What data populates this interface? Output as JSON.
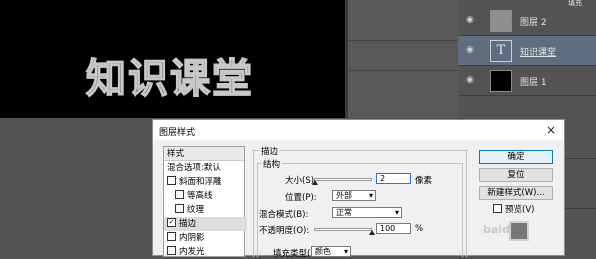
{
  "canvas": {
    "text": "知识课堂"
  },
  "layers": [
    {
      "name": "图层 2",
      "thumb": "gray",
      "selected": false
    },
    {
      "name": "知识课堂",
      "thumb": "text",
      "thumb_glyph": "T",
      "selected": true
    },
    {
      "name": "图层 1",
      "thumb": "black",
      "selected": false
    }
  ],
  "layers_panel": {
    "corner_label": "填充"
  },
  "dialog": {
    "title": "图层样式",
    "close_glyph": "×",
    "style_list": {
      "header": "样式",
      "items": [
        {
          "label": "混合选项:默认",
          "checkbox": false,
          "checked": false,
          "indent": 0
        },
        {
          "label": "斜面和浮雕",
          "checkbox": true,
          "checked": false,
          "indent": 0
        },
        {
          "label": "等高线",
          "checkbox": true,
          "checked": false,
          "indent": 1
        },
        {
          "label": "纹理",
          "checkbox": true,
          "checked": false,
          "indent": 1
        },
        {
          "label": "描边",
          "checkbox": true,
          "checked": true,
          "indent": 0,
          "active": true
        },
        {
          "label": "内阴影",
          "checkbox": true,
          "checked": false,
          "indent": 0
        },
        {
          "label": "内发光",
          "checkbox": true,
          "checked": false,
          "indent": 0
        }
      ]
    },
    "stroke": {
      "group_title": "描边",
      "structure_title": "结构",
      "size_label": "大小(S):",
      "size_value": "2",
      "size_unit": "像素",
      "size_fraction": 0.02,
      "position_label": "位置(P):",
      "position_value": "外部",
      "blend_label": "混合模式(B):",
      "blend_value": "正常",
      "opacity_label": "不透明度(O):",
      "opacity_value": "100",
      "opacity_unit": "%",
      "opacity_fraction": 1.0,
      "fill_type_label": "填充类型(F):",
      "fill_type_value": "颜色"
    },
    "buttons": {
      "ok": "确定",
      "reset": "复位",
      "new_style": "新建样式(W)..."
    },
    "preview_label": "预览(V)",
    "preview_checked": false
  },
  "watermark": "baidu"
}
